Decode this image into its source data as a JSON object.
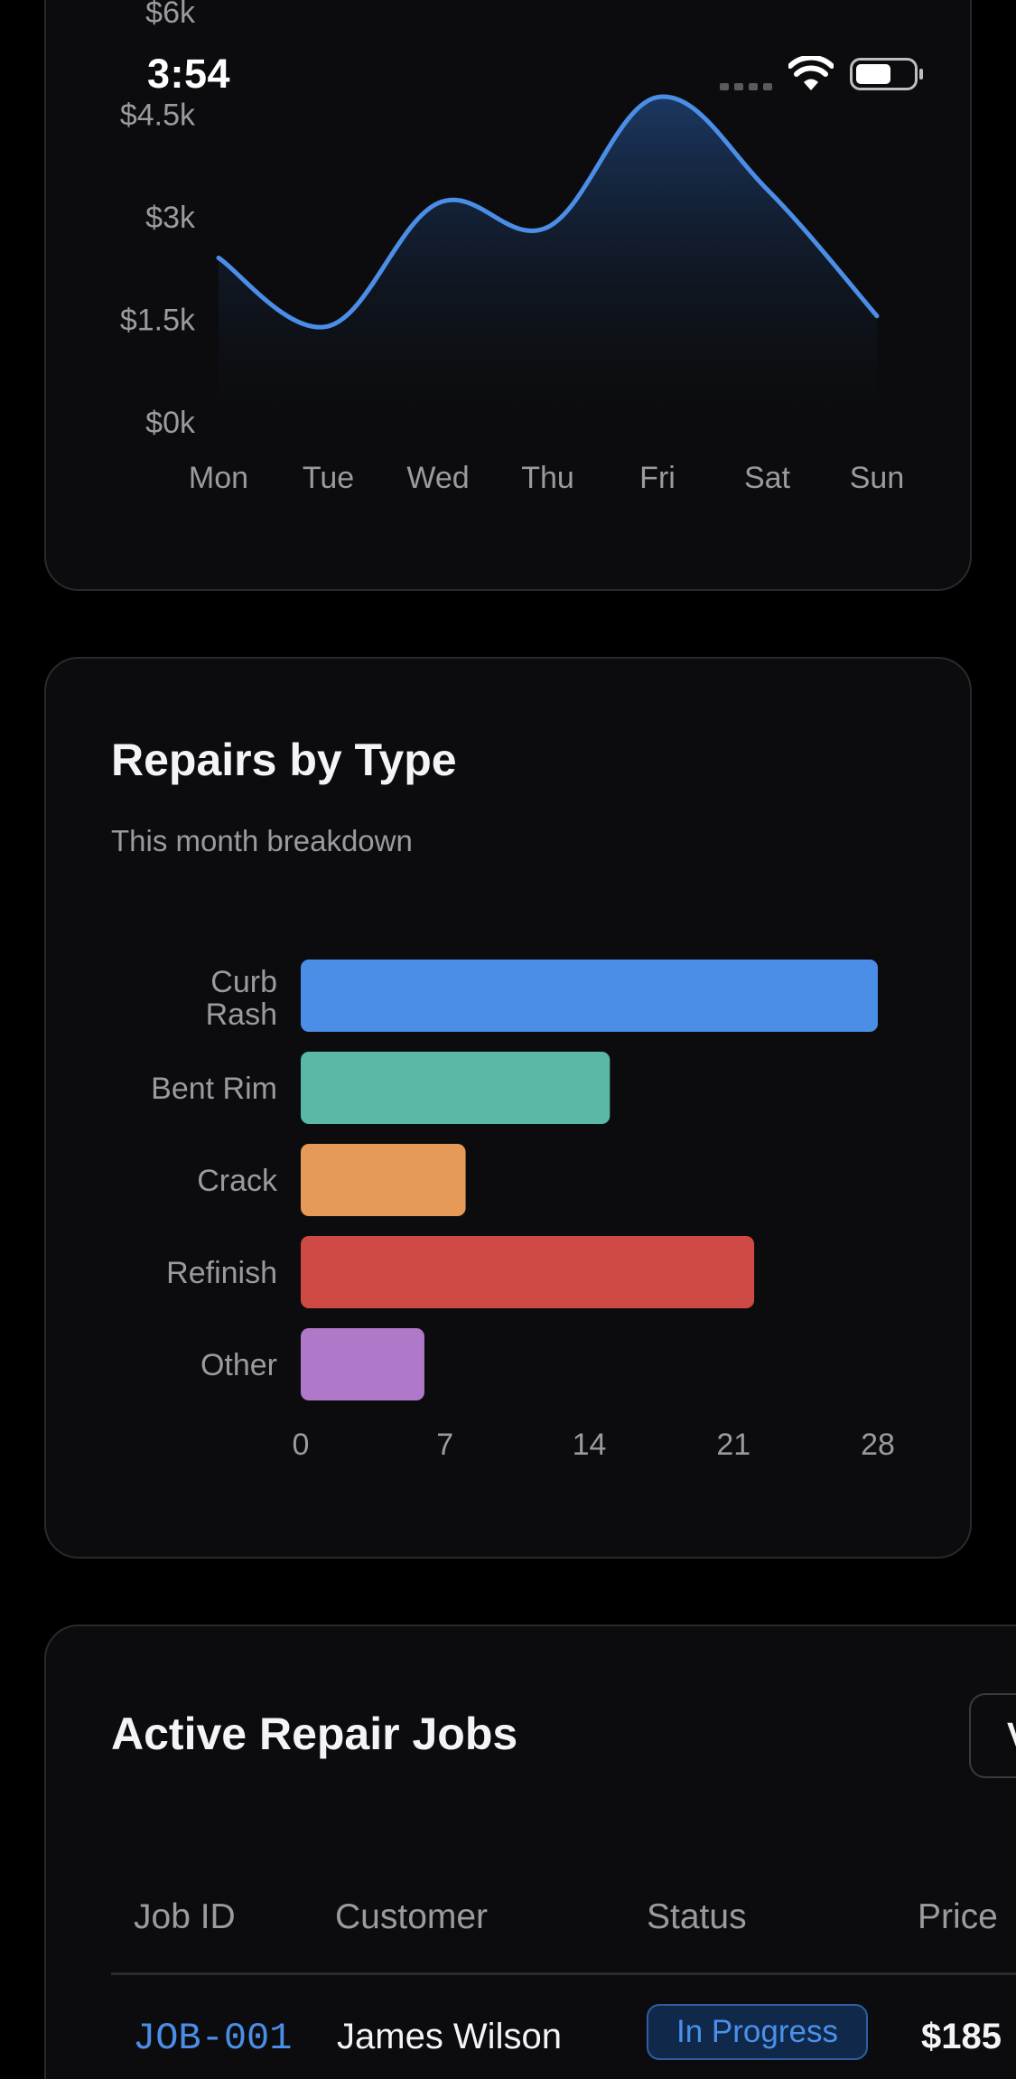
{
  "status_bar": {
    "time": "3:54",
    "signal_icon": "cellular-dots-icon",
    "wifi_icon": "wifi-icon",
    "battery_icon": "battery-icon"
  },
  "revenue_card": {
    "chart_data": {
      "type": "area",
      "x": [
        "Mon",
        "Tue",
        "Wed",
        "Thu",
        "Fri",
        "Sat",
        "Sun"
      ],
      "y_ticks": [
        "$0k",
        "$1.5k",
        "$3k",
        "$4.5k",
        "$6k"
      ],
      "ylim": [
        0,
        6000
      ],
      "series": [
        {
          "values": [
            2400,
            1400,
            3200,
            2850,
            4750,
            3400,
            1550
          ]
        }
      ],
      "line_color": "#4a8ee8",
      "grid": false
    }
  },
  "repairs_card": {
    "title": "Repairs by Type",
    "subtitle": "This month breakdown",
    "chart_data": {
      "type": "bar",
      "orientation": "horizontal",
      "categories": [
        "Curb Rash",
        "Bent Rim",
        "Crack",
        "Refinish",
        "Other"
      ],
      "values": [
        28,
        15,
        8,
        22,
        6
      ],
      "colors": [
        "#4a8ee8",
        "#5ab8a6",
        "#e69a58",
        "#cf4a45",
        "#b078c8"
      ],
      "x_ticks": [
        "0",
        "7",
        "14",
        "21",
        "28"
      ],
      "xlim": [
        0,
        28
      ],
      "grid": false
    }
  },
  "jobs_card": {
    "title": "Active Repair Jobs",
    "view_all_label": "View All",
    "columns": [
      "Job ID",
      "Customer",
      "Status",
      "Price"
    ],
    "rows": [
      {
        "job_id": "JOB-001",
        "customer": "James Wilson",
        "status": "In Progress",
        "price": "$185"
      }
    ]
  }
}
